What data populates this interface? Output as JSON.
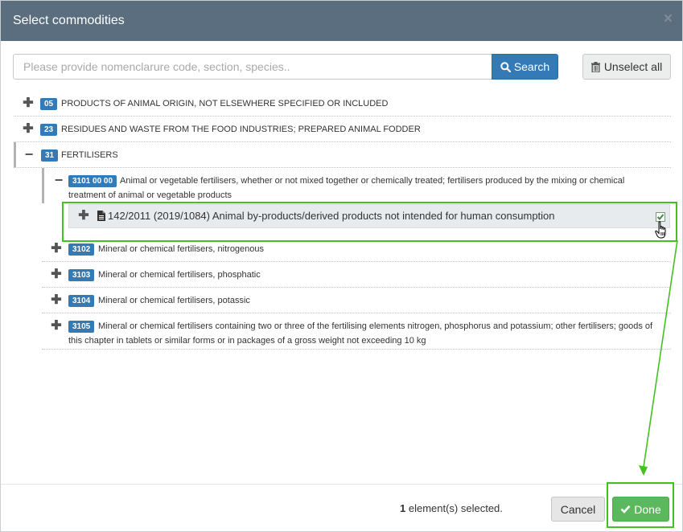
{
  "modal": {
    "title": "Select commodities",
    "close_glyph": "×"
  },
  "search": {
    "placeholder": "Please provide nomenclarure code, section, species..",
    "value": "",
    "button_label": "Search",
    "button_icon": "search-icon"
  },
  "unselect": {
    "label": "Unselect all",
    "icon": "trash-icon"
  },
  "tree": {
    "expand_glyph": "✚",
    "collapse_glyph": "−",
    "sections": [
      {
        "code": "05",
        "label": "PRODUCTS OF ANIMAL ORIGIN, NOT ELSEWHERE SPECIFIED OR INCLUDED",
        "expanded": false
      },
      {
        "code": "23",
        "label": "RESIDUES AND WASTE FROM THE FOOD INDUSTRIES; PREPARED ANIMAL FODDER",
        "expanded": false
      },
      {
        "code": "31",
        "label": "FERTILISERS",
        "expanded": true
      }
    ],
    "children": [
      {
        "code": "3101 00 00",
        "label_line1": "Animal or vegetable fertilisers, whether or not mixed together or chemically treated; fertilisers produced by the mixing or chemical",
        "label_line2": "treatment of animal or vegetable products",
        "expanded": true
      },
      {
        "code": "3102",
        "label": "Mineral or chemical fertilisers, nitrogenous",
        "expanded": false
      },
      {
        "code": "3103",
        "label": "Mineral or chemical fertilisers, phosphatic",
        "expanded": false
      },
      {
        "code": "3104",
        "label": "Mineral or chemical fertilisers, potassic",
        "expanded": false
      },
      {
        "code": "3105",
        "label_line1": "Mineral or chemical fertilisers containing two or three of the fertilising elements nitrogen, phosphorus and potassium; other fertilisers; goods of",
        "label_line2": "this chapter in tablets or similar forms or in packages of a gross weight not exceeding 10 kg",
        "expanded": false
      }
    ],
    "leaf": {
      "label": "142/2011 (2019/1084) Animal by-products/derived products not intended for human consumption",
      "checked": true,
      "icon": "document-icon"
    }
  },
  "footer": {
    "selected_count": "1",
    "selected_suffix": " element(s) selected.",
    "cancel_label": "Cancel",
    "done_label": "Done",
    "done_icon": "checkmark-icon"
  },
  "colors": {
    "header_bg": "#5a6e7f",
    "primary": "#337ab7",
    "success": "#5cb85c",
    "highlight": "#44c020"
  }
}
